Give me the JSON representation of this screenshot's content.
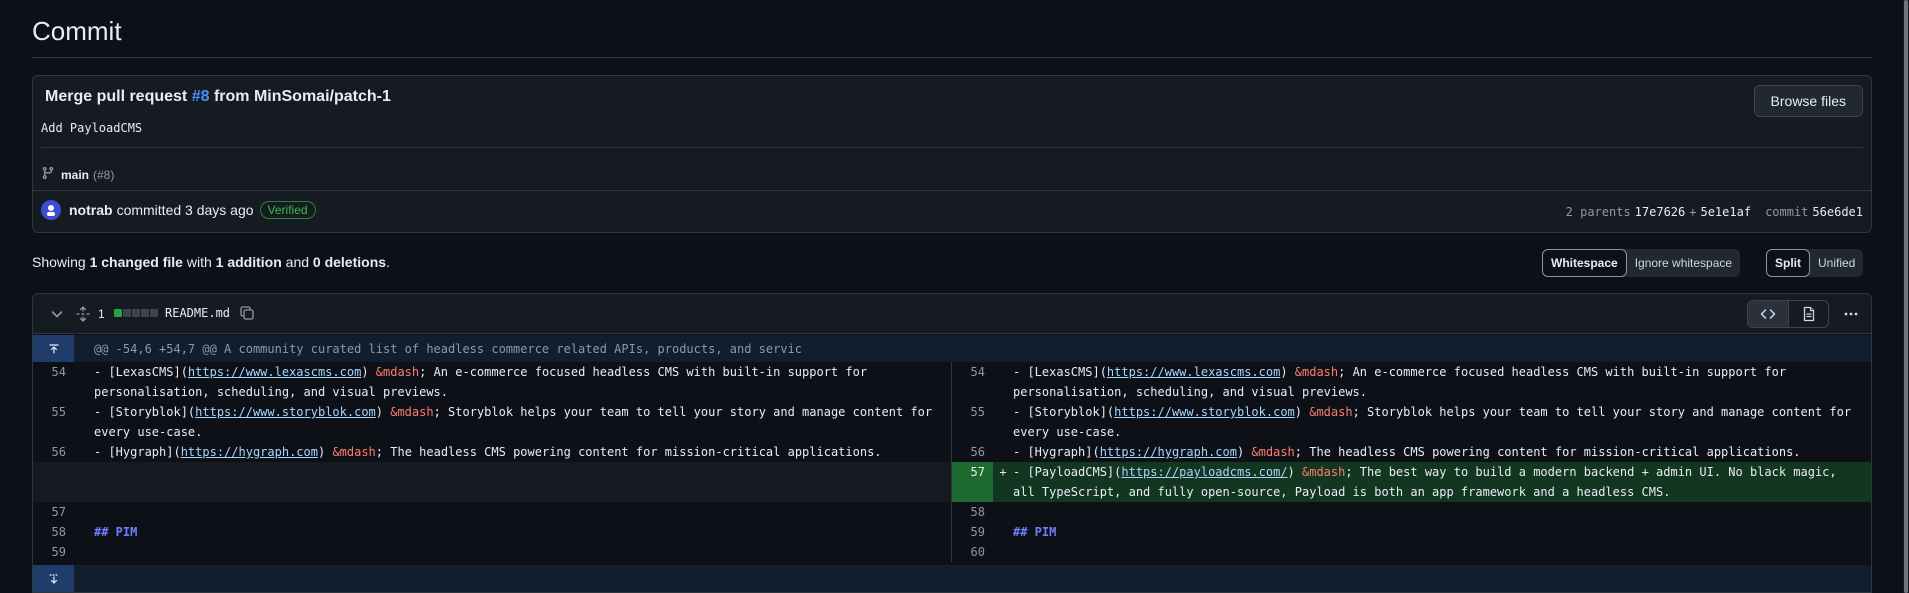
{
  "page": {
    "title": "Commit"
  },
  "commit": {
    "title_prefix": "Merge pull request ",
    "pr_number": "#8",
    "title_suffix": " from MinSomai/patch-1",
    "description": "Add PayloadCMS",
    "browse_label": "Browse files",
    "branch": "main",
    "branch_pr": "(#8)",
    "author": "notrab",
    "committed_text": "committed 3 days ago",
    "verified": "Verified",
    "parents_label": "2 parents",
    "parent1": "17e7626",
    "plus": "+",
    "parent2": "5e1e1af",
    "commit_label": "commit",
    "commit_sha": "56e6de1"
  },
  "summary": {
    "showing": "Showing ",
    "changed": "1 changed file",
    "with": " with ",
    "additions": "1 addition",
    "and": " and ",
    "deletions": "0 deletions",
    "period": "."
  },
  "whitespace_toggle": {
    "active": "Whitespace",
    "inactive": "Ignore whitespace"
  },
  "view_toggle": {
    "active": "Split",
    "inactive": "Unified"
  },
  "file": {
    "change_count": "1",
    "name": "README.md",
    "hunk_header": "@@ -54,6 +54,7 @@ A community curated list of headless commerce related APIs, products, and servic"
  },
  "rows": [
    {
      "left": {
        "ln": "54",
        "parts": [
          [
            "- [LexasCMS](",
            ""
          ],
          [
            "https://www.lexascms.com",
            "url"
          ],
          [
            ") ",
            ""
          ],
          [
            "&mdash",
            "ent"
          ],
          [
            "; An e-commerce focused headless CMS with built-in support for personalisation, scheduling, and visual previews.",
            ""
          ]
        ]
      },
      "right": {
        "ln": "54",
        "parts": [
          [
            "- [LexasCMS](",
            ""
          ],
          [
            "https://www.lexascms.com",
            "url"
          ],
          [
            ") ",
            ""
          ],
          [
            "&mdash",
            "ent"
          ],
          [
            "; An e-commerce focused headless CMS with built-in support for personalisation, scheduling, and visual previews.",
            ""
          ]
        ]
      }
    },
    {
      "left": {
        "ln": "55",
        "parts": [
          [
            "- [Storyblok](",
            ""
          ],
          [
            "https://www.storyblok.com",
            "url"
          ],
          [
            ") ",
            ""
          ],
          [
            "&mdash",
            "ent"
          ],
          [
            "; Storyblok helps your team to tell your story and manage content for every use-case.",
            ""
          ]
        ]
      },
      "right": {
        "ln": "55",
        "parts": [
          [
            "- [Storyblok](",
            ""
          ],
          [
            "https://www.storyblok.com",
            "url"
          ],
          [
            ") ",
            ""
          ],
          [
            "&mdash",
            "ent"
          ],
          [
            "; Storyblok helps your team to tell your story and manage content for every use-case.",
            ""
          ]
        ]
      }
    },
    {
      "left": {
        "ln": "56",
        "parts": [
          [
            "- [Hygraph](",
            ""
          ],
          [
            "https://hygraph.com",
            "url"
          ],
          [
            ") ",
            ""
          ],
          [
            "&mdash",
            "ent"
          ],
          [
            "; The headless CMS powering content for mission-critical applications.",
            ""
          ]
        ]
      },
      "right": {
        "ln": "56",
        "parts": [
          [
            "- [Hygraph](",
            ""
          ],
          [
            "https://hygraph.com",
            "url"
          ],
          [
            ") ",
            ""
          ],
          [
            "&mdash",
            "ent"
          ],
          [
            "; The headless CMS powering content for mission-critical applications.",
            ""
          ]
        ]
      }
    },
    {
      "left": null,
      "right": {
        "ln": "57",
        "sign": "+",
        "added": true,
        "parts": [
          [
            "- [PayloadCMS](",
            ""
          ],
          [
            "https://payloadcms.com/",
            "url"
          ],
          [
            ") ",
            ""
          ],
          [
            "&mdash",
            "ent"
          ],
          [
            "; The best way to build a modern backend + admin UI. No black magic, all TypeScript, and fully open-source, Payload is both an app framework and a headless CMS.",
            ""
          ]
        ]
      }
    },
    {
      "left": {
        "ln": "57",
        "parts": []
      },
      "right": {
        "ln": "58",
        "parts": []
      }
    },
    {
      "left": {
        "ln": "58",
        "parts": [
          [
            "## PIM",
            "hdr"
          ]
        ]
      },
      "right": {
        "ln": "59",
        "parts": [
          [
            "## PIM",
            "hdr"
          ]
        ]
      }
    },
    {
      "left": {
        "ln": "59",
        "parts": []
      },
      "right": {
        "ln": "60",
        "parts": []
      }
    }
  ],
  "colors": {
    "accent": "#4493f8",
    "added_bg": "#12361f",
    "added_ln": "#1f6a2e",
    "verified": "#3fb950",
    "hunk_bg": "#121d2f"
  }
}
